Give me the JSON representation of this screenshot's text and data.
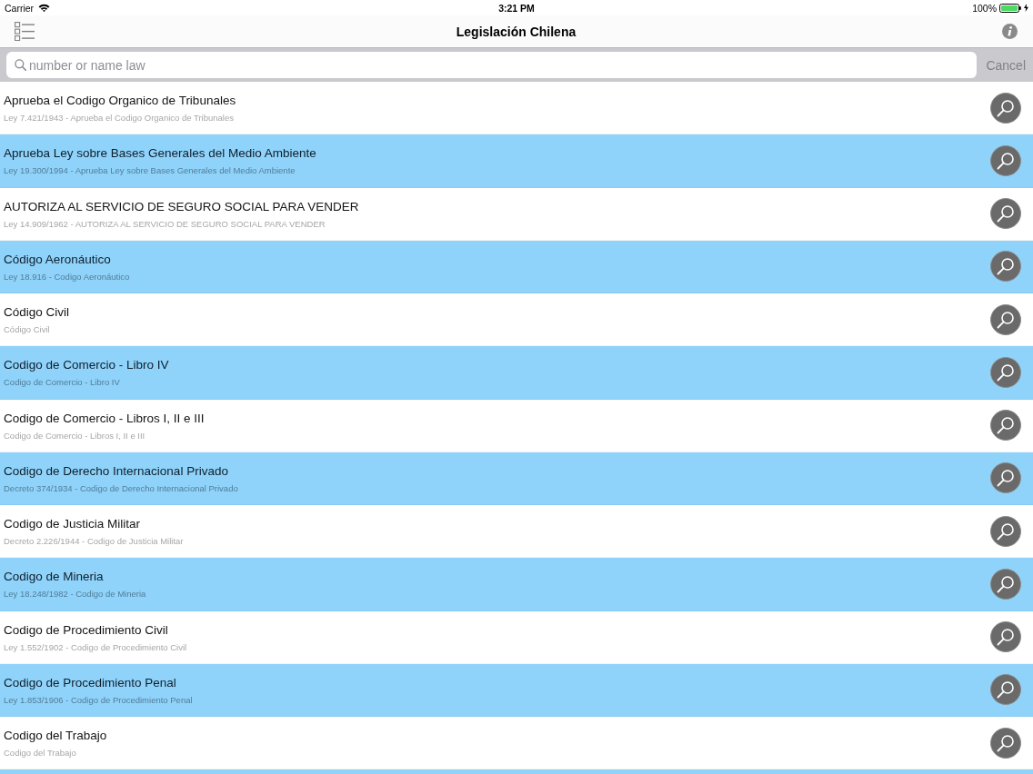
{
  "status_bar": {
    "carrier": "Carrier",
    "time": "3:21 PM",
    "battery": "100%"
  },
  "nav_bar": {
    "title": "Legislación Chilena"
  },
  "search": {
    "placeholder": "number or name law",
    "cancel": {
      "label": "Cancel",
      "disabled": true
    }
  },
  "laws": [
    {
      "title": "Aprueba el Codigo Organico de Tribunales",
      "subtitle": "Ley 7.421/1943 - Aprueba el Codigo Organico de Tribunales"
    },
    {
      "title": "Aprueba Ley sobre Bases Generales del Medio Ambiente",
      "subtitle": "Ley 19.300/1994 - Aprueba Ley sobre Bases Generales del Medio Ambiente"
    },
    {
      "title": "AUTORIZA AL SERVICIO DE SEGURO SOCIAL PARA VENDER",
      "subtitle": "Ley 14.909/1962 - AUTORIZA AL SERVICIO DE SEGURO SOCIAL PARA VENDER"
    },
    {
      "title": "Código Aeronáutico",
      "subtitle": "Ley 18.916 - Codigo Aeronáutico"
    },
    {
      "title": "Código Civil",
      "subtitle": "Código Civil"
    },
    {
      "title": "Codigo de Comercio - Libro IV",
      "subtitle": "Codigo de Comercio - Libro IV"
    },
    {
      "title": "Codigo de Comercio - Libros I, II e III",
      "subtitle": "Codigo de Comercio - Libros I, II e III"
    },
    {
      "title": "Codigo de Derecho Internacional Privado",
      "subtitle": "Decreto 374/1934 - Codigo de Derecho Internacional Privado"
    },
    {
      "title": "Codigo de Justicia Militar",
      "subtitle": "Decreto 2.226/1944 - Codigo de Justicia Militar"
    },
    {
      "title": "Codigo de Mineria",
      "subtitle": "Ley 18.248/1982 - Codigo de Mineria"
    },
    {
      "title": "Codigo de Procedimiento Civil",
      "subtitle": "Ley 1.552/1902 - Codigo de Procedimiento Civil"
    },
    {
      "title": "Codigo de Procedimiento Penal",
      "subtitle": "Ley 1.853/1906 - Codigo de Procedimiento Penal"
    },
    {
      "title": "Codigo del Trabajo",
      "subtitle": "Codigo del Trabajo"
    }
  ]
}
